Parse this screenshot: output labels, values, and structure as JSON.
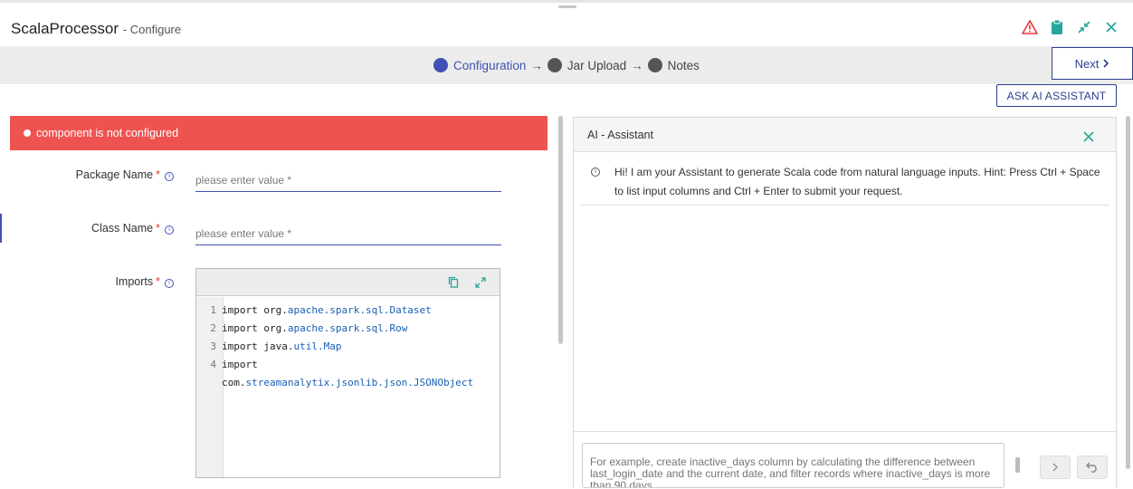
{
  "window": {
    "title": "ScalaProcessor",
    "subtitle": "- Configure",
    "icons": [
      "warning-icon",
      "clipboard-icon",
      "minimize-icon",
      "close-icon"
    ]
  },
  "stepper": {
    "steps": [
      {
        "label": "Configuration",
        "active": true
      },
      {
        "label": "Jar Upload",
        "active": false
      },
      {
        "label": "Notes",
        "active": false
      }
    ],
    "arrow": "→",
    "next_label": "Next"
  },
  "ask_ai_label": "ASK AI ASSISTANT",
  "alert": {
    "message": "component is not configured",
    "color": "#ef5350"
  },
  "form": {
    "package_name": {
      "label": "Package Name",
      "required": "*",
      "placeholder": "please enter value *",
      "value": ""
    },
    "class_name": {
      "label": "Class Name",
      "required": "*",
      "placeholder": "please enter value *",
      "value": ""
    },
    "imports": {
      "label": "Imports",
      "required": "*",
      "lines": [
        {
          "num": "1",
          "plain": "import org.",
          "pkg": "apache.spark.sql.Dataset"
        },
        {
          "num": "2",
          "plain": "import org.",
          "pkg": "apache.spark.sql.Row"
        },
        {
          "num": "3",
          "plain": "import java.",
          "pkg": "util.Map"
        },
        {
          "num": "4",
          "plain": "import",
          "pkg": ""
        },
        {
          "num": "",
          "plain": "com.",
          "pkg": "streamanalytix.jsonlib.json.JSONObject"
        }
      ]
    }
  },
  "ai_assistant": {
    "title": "AI - Assistant",
    "message": "Hi! I am your Assistant to generate Scala code from natural language inputs. Hint: Press Ctrl + Space to list input columns and Ctrl + Enter to submit your request.",
    "input_placeholder": "For example, create inactive_days column by calculating the difference between last_login_date and the current date, and filter records where inactive_days is more than 90 days."
  },
  "colors": {
    "accent": "#3f51b5",
    "error": "#ef5350",
    "warning": "#e53935",
    "teal": "#26a69a"
  }
}
